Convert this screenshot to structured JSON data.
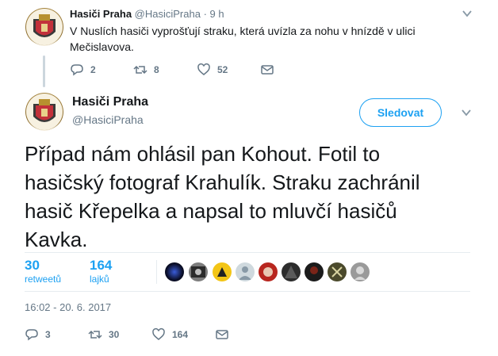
{
  "reply_tweet": {
    "name": "Hasiči Praha",
    "handle": "@HasiciPraha",
    "separator": "·",
    "time": "9 h",
    "text_line1": "V Nuslích hasiči vyprošťují straku, která uvízla za nohu v hnízdě v ulici",
    "text_line2": "Mečislavova.",
    "replies": "2",
    "retweets": "8",
    "likes": "52"
  },
  "main_tweet": {
    "name": "Hasiči Praha",
    "handle": "@HasiciPraha",
    "follow_label": "Sledovat",
    "text_line1": "Případ nám ohlásil pan Kohout. Fotil to",
    "text_line2": "hasičský fotograf Krahulík. Straku zachránil",
    "text_line3": "hasič Křepelka a napsal to mluvčí hasičů",
    "text_line4": "Kavka.",
    "retweet_count": "30",
    "retweet_label": "retweetů",
    "like_count": "164",
    "like_label": "lajků",
    "timestamp": "16:02 - 20. 6. 2017",
    "replies": "3",
    "retweets": "30",
    "likes": "164"
  },
  "colors": {
    "accent": "#1da1f2",
    "muted": "#657786",
    "text": "#14171a",
    "separator": "#e6ecf0"
  },
  "liker_avatars": [
    "dark-blue",
    "photo-gray",
    "yellow",
    "gray-user",
    "red",
    "dark",
    "dark-red",
    "olive",
    "green-x",
    "gray-face"
  ]
}
